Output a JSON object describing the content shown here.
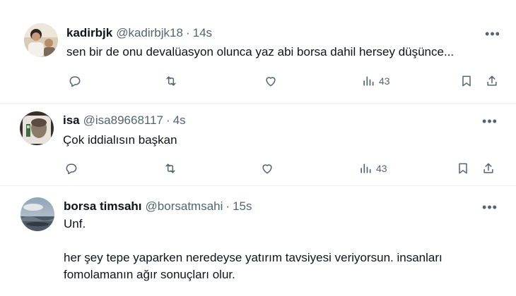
{
  "tweets": [
    {
      "name": "kadirbjk",
      "handle": "@kadirbjk18",
      "separator": "·",
      "time": "14s",
      "text_lines": [
        "sen bir de onu devalüasyon olunca yaz abi borsa dahil hersey düşünce..."
      ],
      "views": "43"
    },
    {
      "name": "isa",
      "handle": "@isa89668117",
      "separator": "·",
      "time": "4s",
      "text_lines": [
        "Çok iddialısın başkan"
      ],
      "views": "43"
    },
    {
      "name": "borsa timsahı",
      "handle": "@borsatmsahi",
      "separator": "·",
      "time": "15s",
      "text_lines": [
        "Unf.",
        "",
        "her şey tepe yaparken neredeyse yatırım tavsiyesi veriyorsun. insanları",
        "fomolamanın ağır sonuçları olur."
      ],
      "views": ""
    }
  ],
  "icons": {
    "reply": "reply-icon",
    "repost": "repost-icon",
    "like": "like-icon",
    "views": "views-icon",
    "bookmark": "bookmark-icon",
    "share": "share-icon",
    "more": "more-icon"
  },
  "colors": {
    "text": "#0f1419",
    "secondary": "#536471",
    "divider": "#eff3f4"
  }
}
